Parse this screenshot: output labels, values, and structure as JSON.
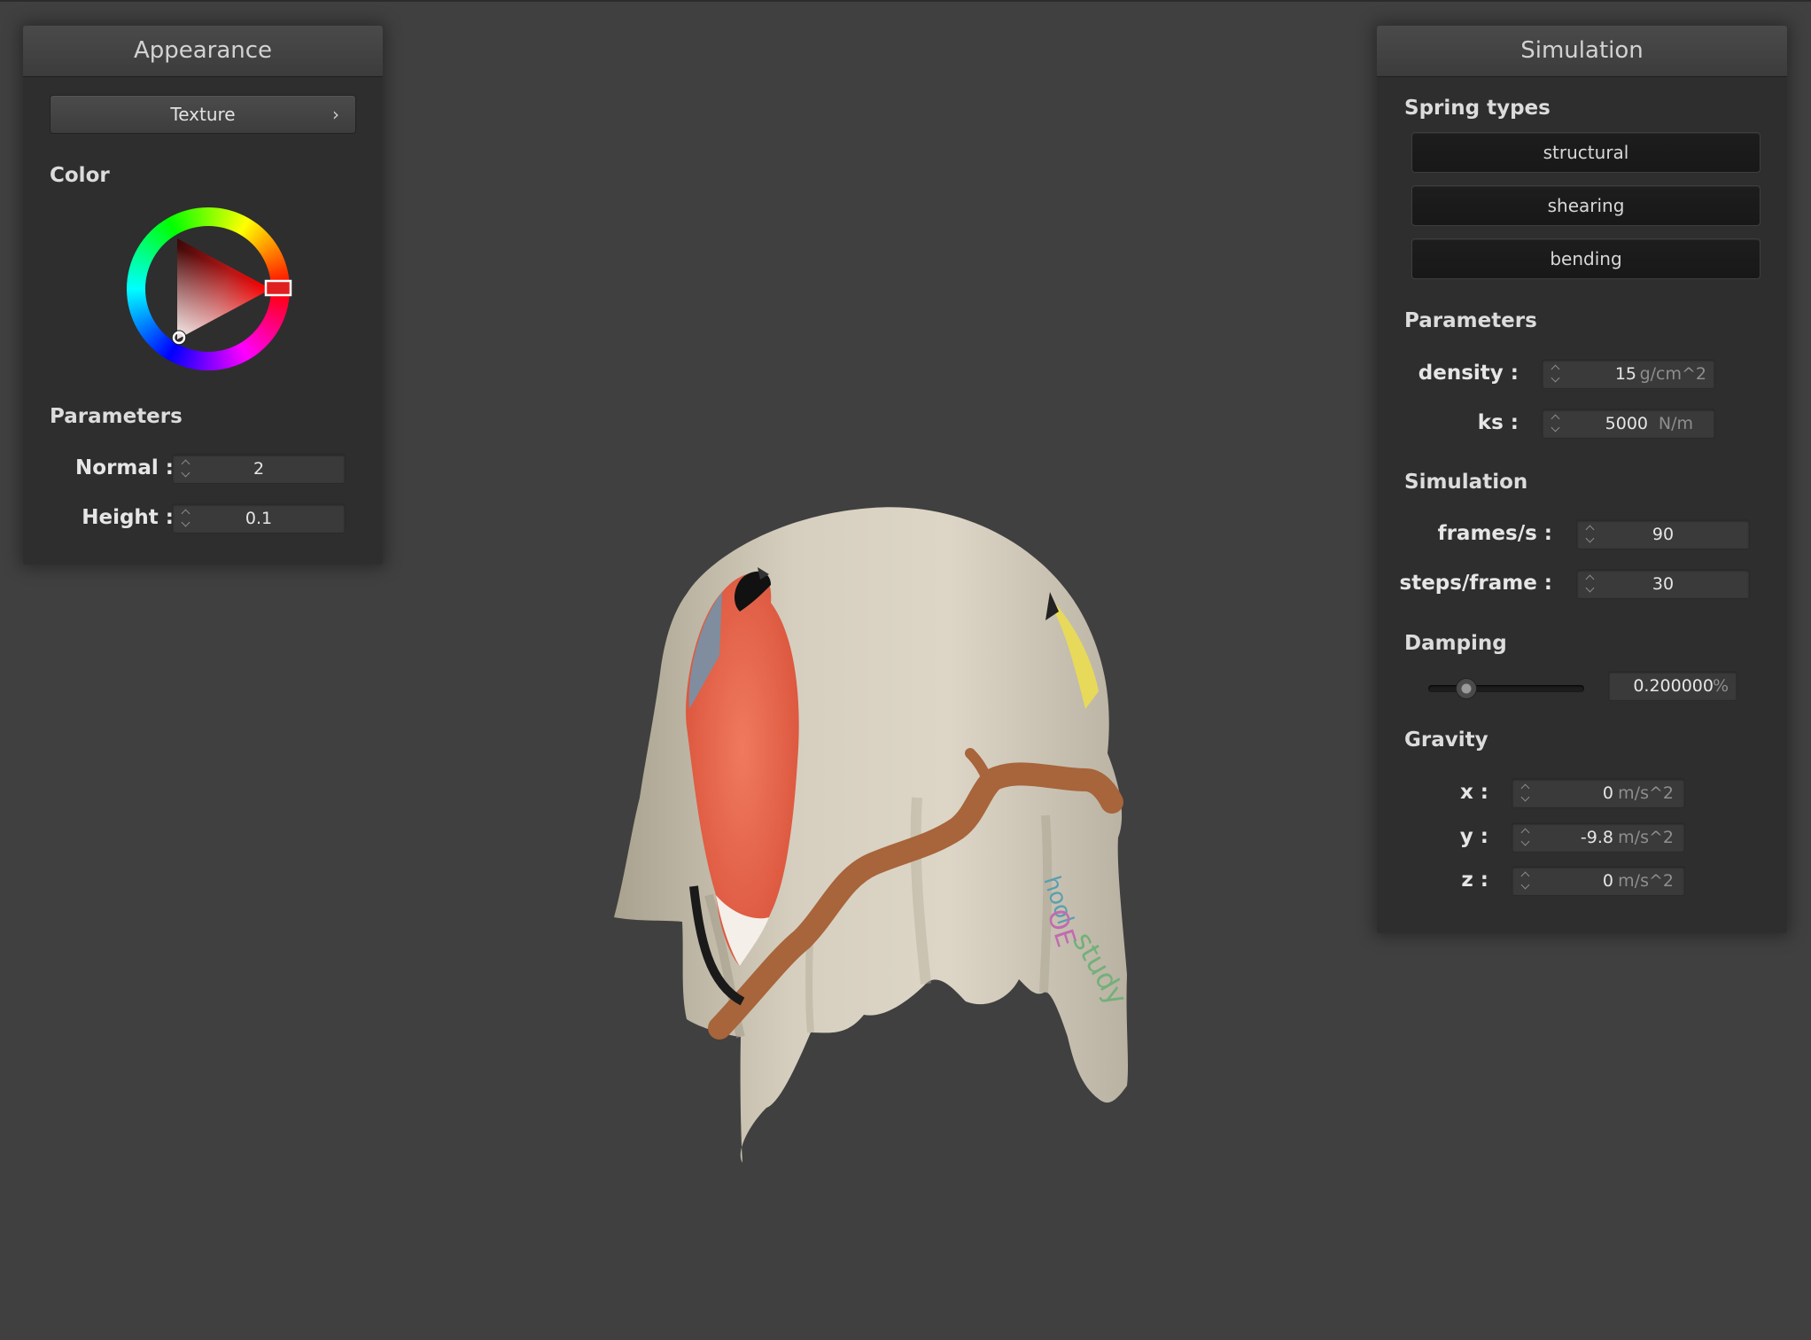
{
  "appearance": {
    "title": "Appearance",
    "texture_button": "Texture",
    "color_label": "Color",
    "parameters_label": "Parameters",
    "normal_label": "Normal :",
    "normal_value": "2",
    "height_label": "Height :",
    "height_value": "0.1"
  },
  "simulation_panel": {
    "title": "Simulation",
    "spring_types_label": "Spring types",
    "spring_buttons": [
      "structural",
      "shearing",
      "bending"
    ],
    "parameters_label": "Parameters",
    "density_label": "density :",
    "density_value": "15",
    "density_unit": "g/cm^2",
    "ks_label": "ks :",
    "ks_value": "5000",
    "ks_unit": "N/m",
    "simulation_label": "Simulation",
    "fps_label": "frames/s :",
    "fps_value": "90",
    "steps_label": "steps/frame :",
    "steps_value": "30",
    "damping_label": "Damping",
    "damping_slider_fraction": 0.2,
    "damping_value": "0.200000",
    "damping_unit": "%",
    "gravity_label": "Gravity",
    "gx_label": "x :",
    "gx_value": "0",
    "gy_label": "y :",
    "gy_value": "-9.8",
    "gz_label": "z :",
    "gz_value": "0",
    "gravity_unit": "m/s^2"
  },
  "colors": {
    "background": "#404040",
    "panel": "#2e2e2e",
    "selected_color": "#e02020"
  }
}
